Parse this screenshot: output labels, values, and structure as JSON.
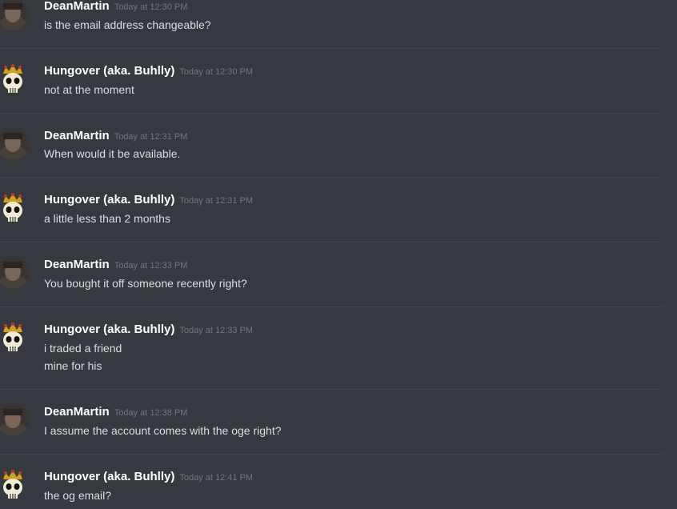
{
  "messages": [
    {
      "author": "DeanMartin",
      "timestamp": "Today at 12:30 PM",
      "lines": [
        "is the email address changeable?"
      ],
      "avatar": "dean-avatar-icon"
    },
    {
      "author": "Hungover (aka. Buhlly)",
      "timestamp": "Today at 12:30 PM",
      "lines": [
        "not at the moment"
      ],
      "avatar": "crowned-skull-avatar-icon"
    },
    {
      "author": "DeanMartin",
      "timestamp": "Today at 12:31 PM",
      "lines": [
        "When would it be available."
      ],
      "avatar": "dean-avatar-icon"
    },
    {
      "author": "Hungover (aka. Buhlly)",
      "timestamp": "Today at 12:31 PM",
      "lines": [
        "a little less than 2 months"
      ],
      "avatar": "crowned-skull-avatar-icon"
    },
    {
      "author": "DeanMartin",
      "timestamp": "Today at 12:33 PM",
      "lines": [
        "You bought it off someone recently right?"
      ],
      "avatar": "dean-avatar-icon"
    },
    {
      "author": "Hungover (aka. Buhlly)",
      "timestamp": "Today at 12:33 PM",
      "lines": [
        "i traded a friend",
        "mine for his"
      ],
      "avatar": "crowned-skull-avatar-icon"
    },
    {
      "author": "DeanMartin",
      "timestamp": "Today at 12:38 PM",
      "lines": [
        "I assume the account comes with the oge right?"
      ],
      "avatar": "dean-avatar-icon"
    },
    {
      "author": "Hungover (aka. Buhlly)",
      "timestamp": "Today at 12:41 PM",
      "lines": [
        "the og email?"
      ],
      "avatar": "crowned-skull-avatar-icon"
    }
  ],
  "colors": {
    "background": "#36393f",
    "username": "#ffffff",
    "message_text": "#dcddde",
    "timestamp": "#72767d",
    "divider": "#40434a"
  }
}
